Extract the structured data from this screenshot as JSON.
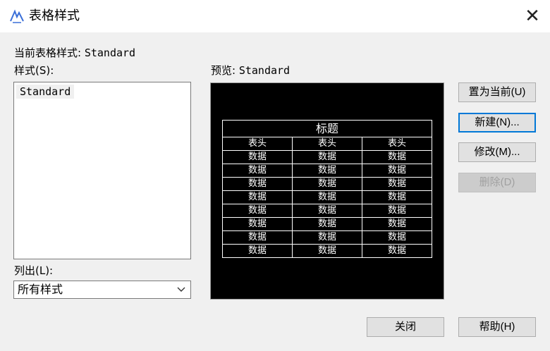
{
  "window": {
    "title": "表格样式",
    "close_glyph": "✕",
    "app_icon": "table-style-app-icon"
  },
  "current_style": {
    "label": "当前表格样式: ",
    "value": "Standard"
  },
  "styles": {
    "label": "样式(S):",
    "items": [
      "Standard"
    ]
  },
  "preview": {
    "label": "预览: ",
    "style_name": "Standard",
    "table": {
      "title": "标题",
      "headers": [
        "表头",
        "表头",
        "表头"
      ],
      "row_cell": "数据",
      "rows": 8
    }
  },
  "list_filter": {
    "label": "列出(L):",
    "selected": "所有样式"
  },
  "buttons": {
    "set_current": "置为当前(U)",
    "new": "新建(N)...",
    "modify": "修改(M)...",
    "delete": "删除(D)",
    "close": "关闭",
    "help": "帮助(H)"
  },
  "colors": {
    "accent": "#0078d7",
    "preview_bg": "#000000",
    "dialog_bg": "#f0f0f0"
  }
}
